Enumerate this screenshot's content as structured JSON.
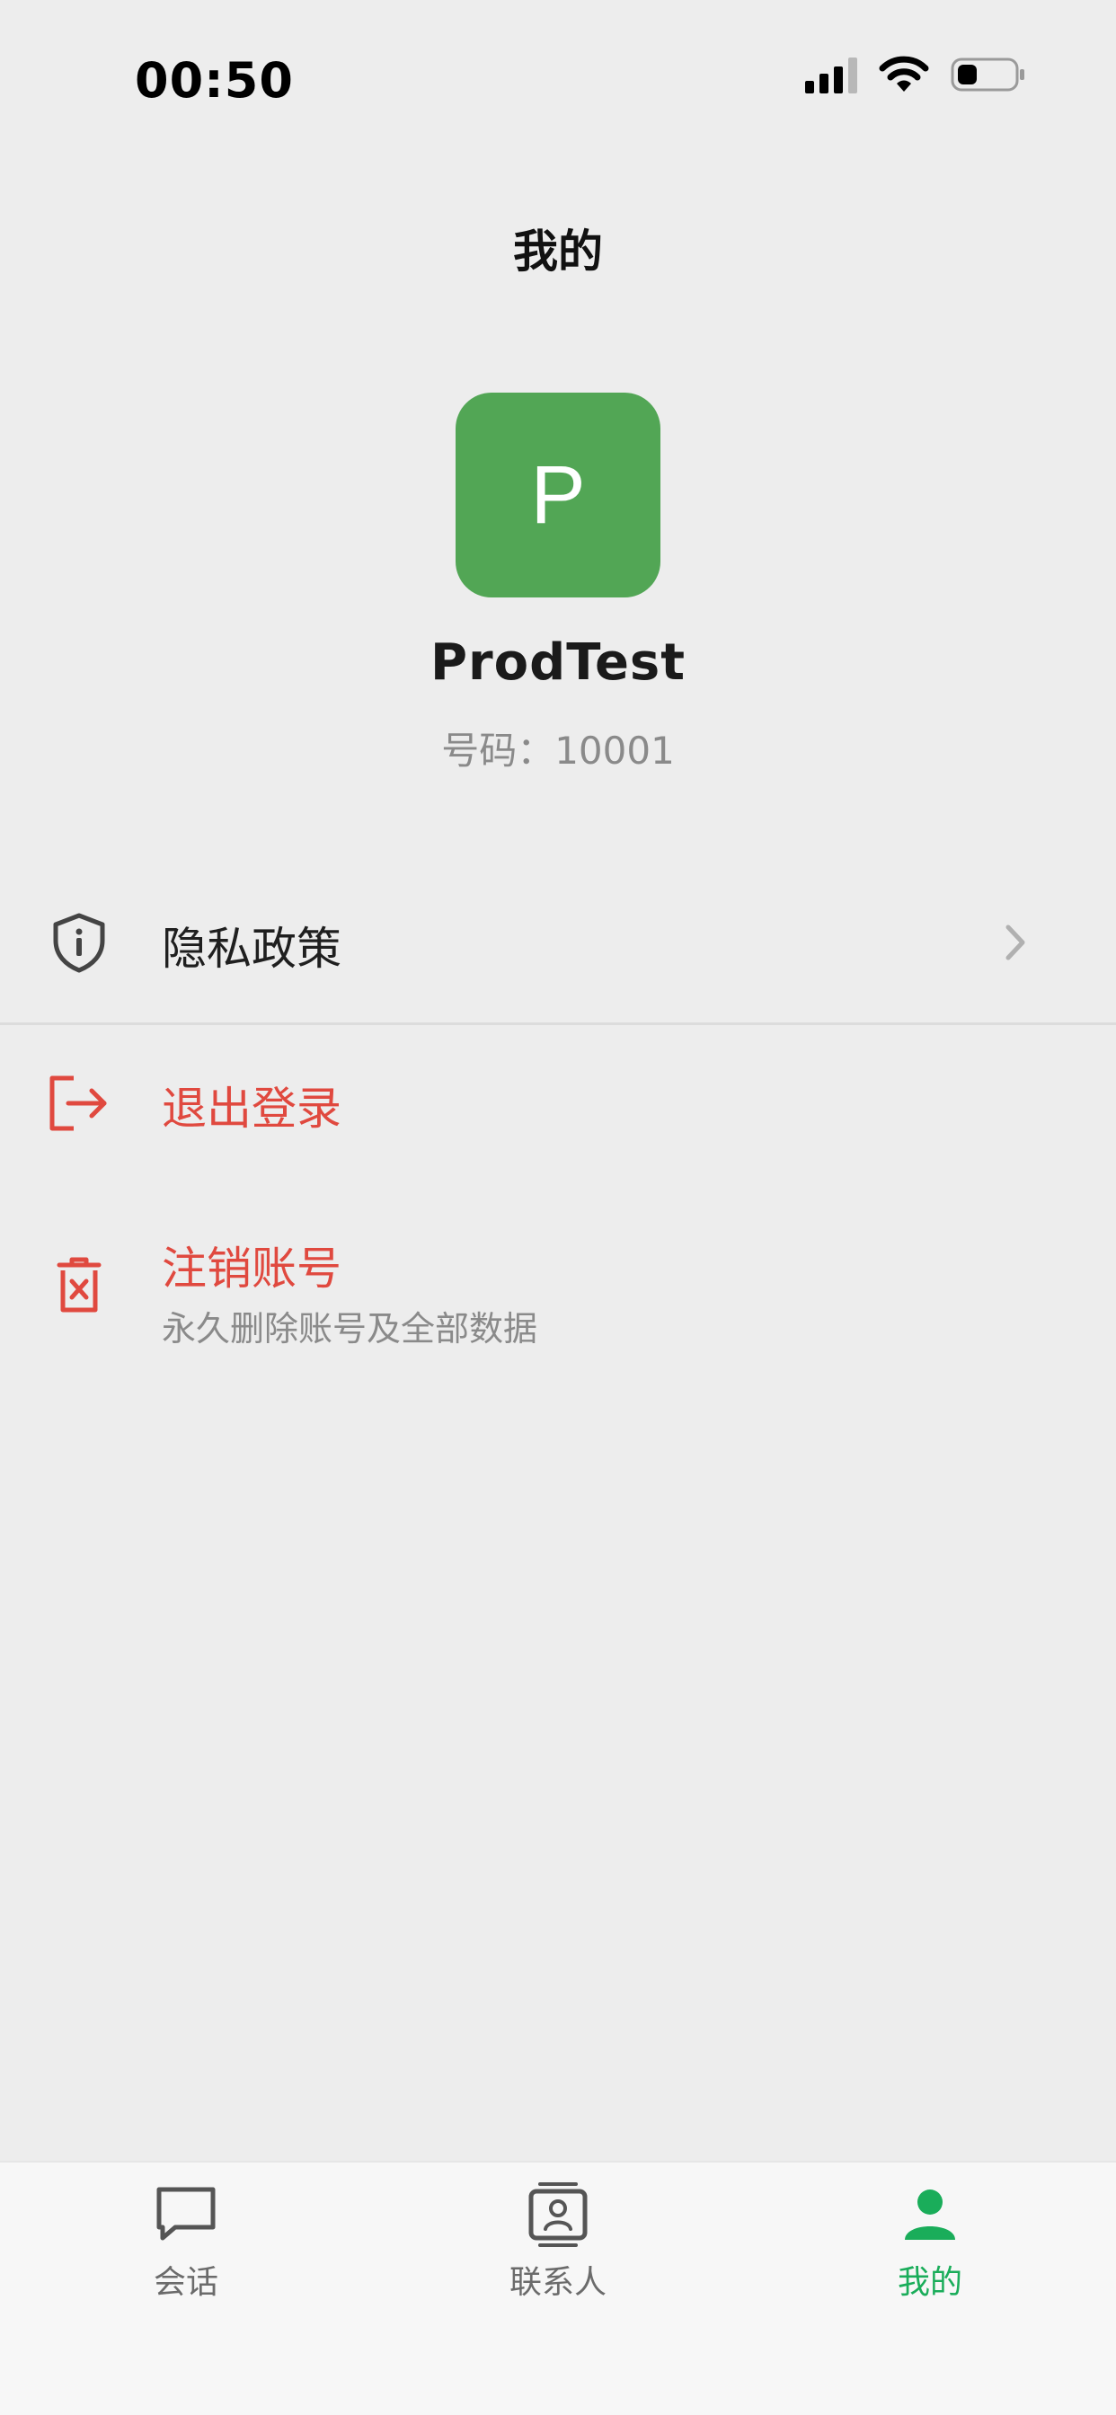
{
  "status_bar": {
    "time": "00:50",
    "icons": [
      "signal-icon",
      "wifi-icon",
      "battery-icon"
    ],
    "battery_level": 0.35
  },
  "header": {
    "title": "我的"
  },
  "profile": {
    "avatar_letter": "P",
    "avatar_color": "#52a655",
    "name": "ProdTest",
    "id_line": "号码：10001"
  },
  "menu": {
    "privacy": {
      "label": "隐私政策",
      "icon": "shield-info-icon"
    },
    "logout": {
      "label": "退出登录",
      "icon": "logout-icon"
    },
    "delete_account": {
      "label": "注销账号",
      "sublabel": "永久删除账号及全部数据",
      "icon": "trash-icon"
    }
  },
  "colors": {
    "danger": "#e0493f",
    "accent": "#1aad5a",
    "background": "#ededed"
  },
  "tab_bar": {
    "tabs": [
      {
        "label": "会话",
        "icon": "chat-bubble-icon",
        "active": false
      },
      {
        "label": "联系人",
        "icon": "contacts-icon",
        "active": false
      },
      {
        "label": "我的",
        "icon": "person-icon",
        "active": true
      }
    ]
  }
}
